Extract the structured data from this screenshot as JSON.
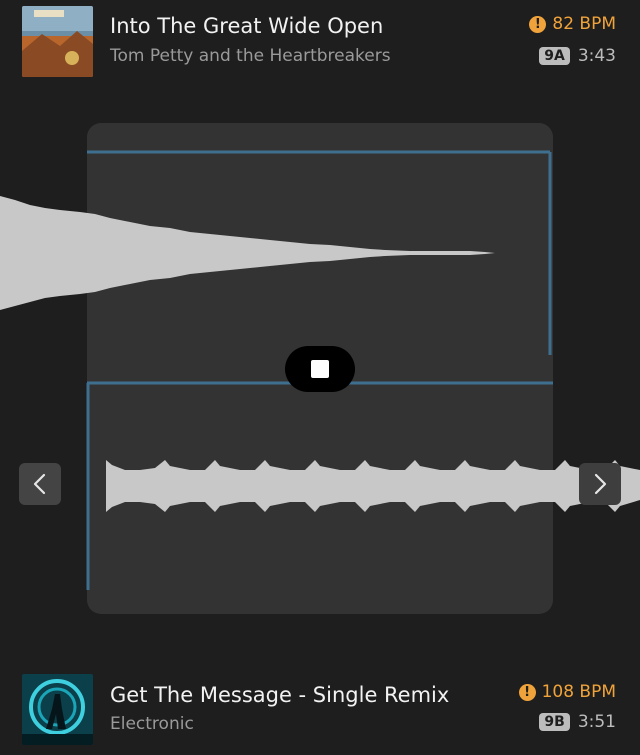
{
  "current_track": {
    "title": "Into The Great Wide Open",
    "artist": "Tom Petty and the Heartbreakers",
    "bpm": "82 BPM",
    "key": "9A",
    "duration": "3:43",
    "warning_icon": "warning-icon",
    "bpm_color": "#f0a33a"
  },
  "next_track": {
    "title": "Get The Message - Single Remix",
    "genre": "Electronic",
    "bpm": "108 BPM",
    "key": "9B",
    "duration": "3:51",
    "warning_icon": "warning-icon"
  },
  "controls": {
    "stop_icon": "stop-icon",
    "prev_icon": "chevron-left-icon",
    "next_icon": "chevron-right-icon"
  },
  "colors": {
    "accent": "#f0a33a",
    "beat_grid": "#3f6f8f",
    "waveform": "#c8c8c8"
  }
}
